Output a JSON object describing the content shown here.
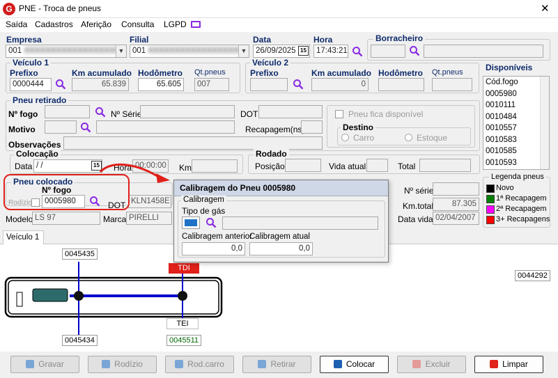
{
  "window": {
    "title": "PNE - Troca de pneus",
    "app_icon": "G",
    "close": "✕"
  },
  "menu": [
    "Saída",
    "Cadastros",
    "Aferição",
    "Consulta",
    "LGPD"
  ],
  "empresa": {
    "label": "Empresa",
    "value": "001"
  },
  "filial": {
    "label": "Filial",
    "value": "001"
  },
  "data": {
    "label": "Data",
    "value": "26/09/2025"
  },
  "hora": {
    "label": "Hora",
    "value": "17:43:21"
  },
  "borracheiro": {
    "label": "Borracheiro",
    "code": "",
    "name": ""
  },
  "veiculo1": {
    "title": "Veículo 1",
    "prefixo_label": "Prefixo",
    "prefixo": "0000444",
    "km_label": "Km acumulado",
    "km": "65.839",
    "hodometro_label": "Hodômetro",
    "hodometro": "65.605",
    "qt_label": "Qt.pneus",
    "qt": "007"
  },
  "veiculo2": {
    "title": "Veículo 2",
    "prefixo_label": "Prefixo",
    "prefixo": "",
    "km_label": "Km acumulado",
    "km": "0",
    "hodometro_label": "Hodômetro",
    "hodometro": "",
    "qt_label": "Qt.pneus",
    "qt": ""
  },
  "disponiveis": {
    "title": "Disponíveis",
    "header": "Cód.fogo",
    "items": [
      "0005980",
      "0010111",
      "0010484",
      "0010557",
      "0010583",
      "0010585",
      "0010593"
    ]
  },
  "pneu_retirado": {
    "title": "Pneu retirado",
    "nfogo_label": "Nº fogo",
    "nserie_label": "Nº Série",
    "dot_label": "DOT",
    "motivo_label": "Motivo",
    "recap_label": "Recapagem(ns)",
    "obs_label": "Observações",
    "fica_disponivel": "Pneu fica disponível",
    "destino_title": "Destino",
    "destino_carro": "Carro",
    "destino_estoque": "Estoque"
  },
  "colocacao": {
    "title": "Colocação",
    "data_label": "Data",
    "data": " / /",
    "hora_label": "Hora",
    "hora": "00:00:00",
    "km_label": "Km"
  },
  "rodado": {
    "title": "Rodado",
    "posicao_label": "Posição",
    "vida_label": "Vida atual",
    "total_label": "Total"
  },
  "pneu_colocado": {
    "title": "Pneu colocado",
    "nfogo_label": "Nº fogo",
    "nfogo": "0005980",
    "rodizio_label": "Rodízio",
    "dot_label": "DOT",
    "dot": "KLN1458E",
    "modelo_label": "Modelo",
    "modelo": "LS 97",
    "marca_label": "Marca",
    "marca": "PIRELLI",
    "nserie_label": "Nº série",
    "kmtotal_label": "Km.total",
    "kmtotal": "87.305",
    "datavida_label": "Data vida",
    "datavida": "02/04/2007"
  },
  "legenda": {
    "title": "Legenda pneus",
    "items": [
      {
        "label": "Novo",
        "color": "#000000"
      },
      {
        "label": "1ª Recapagem",
        "color": "#008000"
      },
      {
        "label": "2ª Recapagem",
        "color": "#ff00ff"
      },
      {
        "label": "3+ Recapagens",
        "color": "#ff0000"
      }
    ]
  },
  "tab": {
    "label": "Veículo 1"
  },
  "diagram": {
    "top_left": "0045435",
    "tdi": "TDI",
    "bottom_left": "0045434",
    "tei": "TEI",
    "bottom_right": "0045511",
    "right_spare": "0044292"
  },
  "popup": {
    "title": "Calibragem do Pneu 0005980",
    "group": "Calibragem",
    "tipo_gas_label": "Tipo de gás",
    "anterior_label": "Calibragem anterior",
    "anterior": "0,0",
    "atual_label": "Calibragem atual",
    "atual": "0,0"
  },
  "buttons": {
    "gravar": "Gravar",
    "rodizio": "Rodízio",
    "rodcarro": "Rod.carro",
    "retirar": "Retirar",
    "colocar": "Colocar",
    "excluir": "Excluir",
    "limpar": "Limpar"
  },
  "colors": {
    "accent": "#8a2be2",
    "highlight_red": "#e0201a",
    "group_title": "#0d2a6b",
    "axle_blue": "#0000cc"
  }
}
